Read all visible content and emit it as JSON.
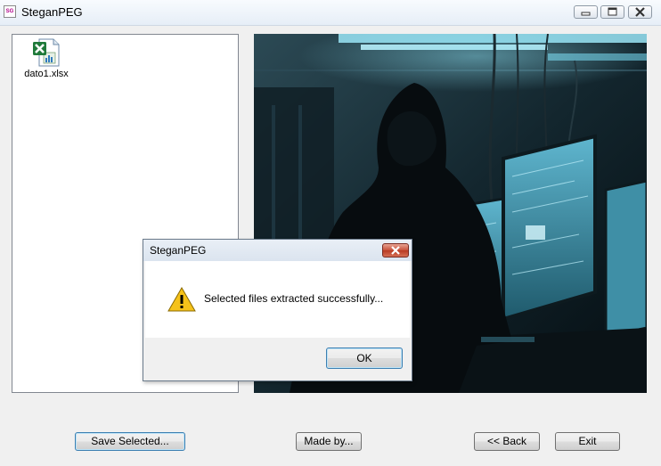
{
  "window": {
    "title": "SteganPEG",
    "app_icon_text": "SG",
    "controls": [
      "minimize-icon",
      "restore-icon",
      "close-icon"
    ]
  },
  "file_list": {
    "items": [
      {
        "name": "dato1.xlsx",
        "icon": "excel-file-icon"
      }
    ]
  },
  "image_panel": {
    "description_icon": "hacker-image"
  },
  "buttons": {
    "save_selected": "Save Selected...",
    "made_by": "Made by...",
    "back": "<< Back",
    "exit": "Exit"
  },
  "dialog": {
    "title": "SteganPEG",
    "message": "Selected files extracted successfully...",
    "ok": "OK",
    "icon": "warning-icon"
  },
  "colors": {
    "titlebar": "#e6eef7",
    "dialog_close": "#c7503a",
    "focus_border": "#3c7fb1",
    "screen_glow": "#5fd4ec"
  }
}
